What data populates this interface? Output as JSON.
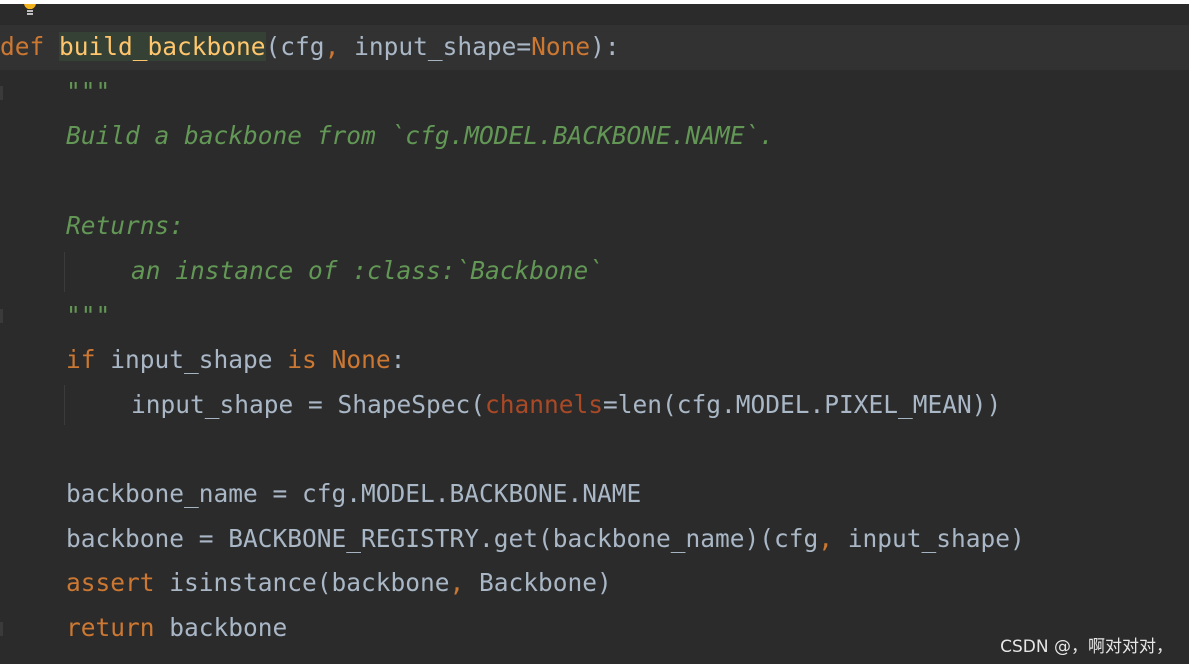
{
  "editor": {
    "language": "python",
    "theme_colors": {
      "background": "#2b2b2b",
      "keyword": "#cc7832",
      "function_name": "#ffc66d",
      "docstring": "#629755",
      "default_text": "#a9b7c6",
      "named_argument": "#aa4926"
    },
    "gutter_icon": "lightbulb-icon",
    "lines": {
      "l1": {
        "def": "def",
        "name": "build_backbone",
        "args_open": "(cfg",
        "comma": ",",
        "args_rest": " input_shape=",
        "none": "None",
        "args_close": "):"
      },
      "l2": {
        "doc": "\"\"\""
      },
      "l3": {
        "doc": "Build a backbone from `cfg.MODEL.BACKBONE.NAME`."
      },
      "l5": {
        "doc": "Returns:"
      },
      "l6": {
        "doc": "an instance of :class:`Backbone`"
      },
      "l7": {
        "doc": "\"\"\""
      },
      "l8": {
        "if": "if",
        "mid": " input_shape ",
        "is": "is",
        "sp": " ",
        "none": "None",
        "colon": ":"
      },
      "l9": {
        "pre": "input_shape = ShapeSpec(",
        "param": "channels",
        "post": "=len(cfg.MODEL.PIXEL_MEAN))"
      },
      "l11": {
        "text": "backbone_name = cfg.MODEL.BACKBONE.NAME"
      },
      "l12": {
        "pre": "backbone = BACKBONE_REGISTRY.get(backbone_name)(cfg",
        "comma": ",",
        "post": " input_shape)"
      },
      "l13": {
        "assert": "assert",
        "pre": " isinstance(backbone",
        "comma": ",",
        "post": " Backbone)"
      },
      "l14": {
        "return": "return",
        "post": " backbone"
      }
    }
  },
  "watermark": "CSDN @，啊对对对，"
}
